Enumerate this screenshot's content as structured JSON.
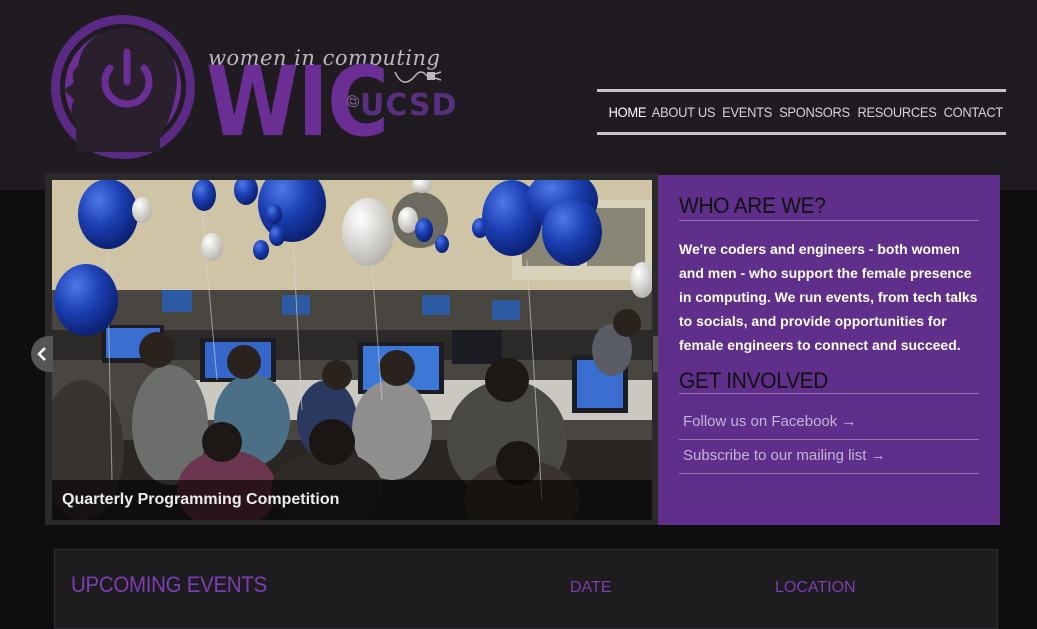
{
  "logo": {
    "tagline": "women in computing",
    "wordmark": "WIC",
    "at": "@",
    "ucsd": "UCSD",
    "brand_color": "#6a2e95"
  },
  "nav": {
    "items": [
      {
        "label": "HOME",
        "active": true
      },
      {
        "label": "ABOUT US",
        "active": false
      },
      {
        "label": "EVENTS",
        "active": false
      },
      {
        "label": "SPONSORS",
        "active": false
      },
      {
        "label": "RESOURCES",
        "active": false
      },
      {
        "label": "CONTACT",
        "active": false
      }
    ]
  },
  "slider": {
    "caption": "Quarterly Programming Competition",
    "prev_icon": "chevron-left-icon",
    "next_icon": "chevron-right-icon"
  },
  "panel": {
    "who_heading": "WHO ARE WE?",
    "about_text": "We're coders and engineers - both women and men - who support the female presence in computing. We run events, from tech talks to socials, and provide opportunities for female engineers to connect and succeed.",
    "involved_heading": "GET INVOLVED",
    "facebook_link": "Follow us on Facebook →",
    "mailing_link": "Subscribe to our mailing list →",
    "panel_color": "#5f2f8b"
  },
  "events": {
    "title": "UPCOMING EVENTS",
    "date_header": "DATE",
    "location_header": "LOCATION"
  }
}
